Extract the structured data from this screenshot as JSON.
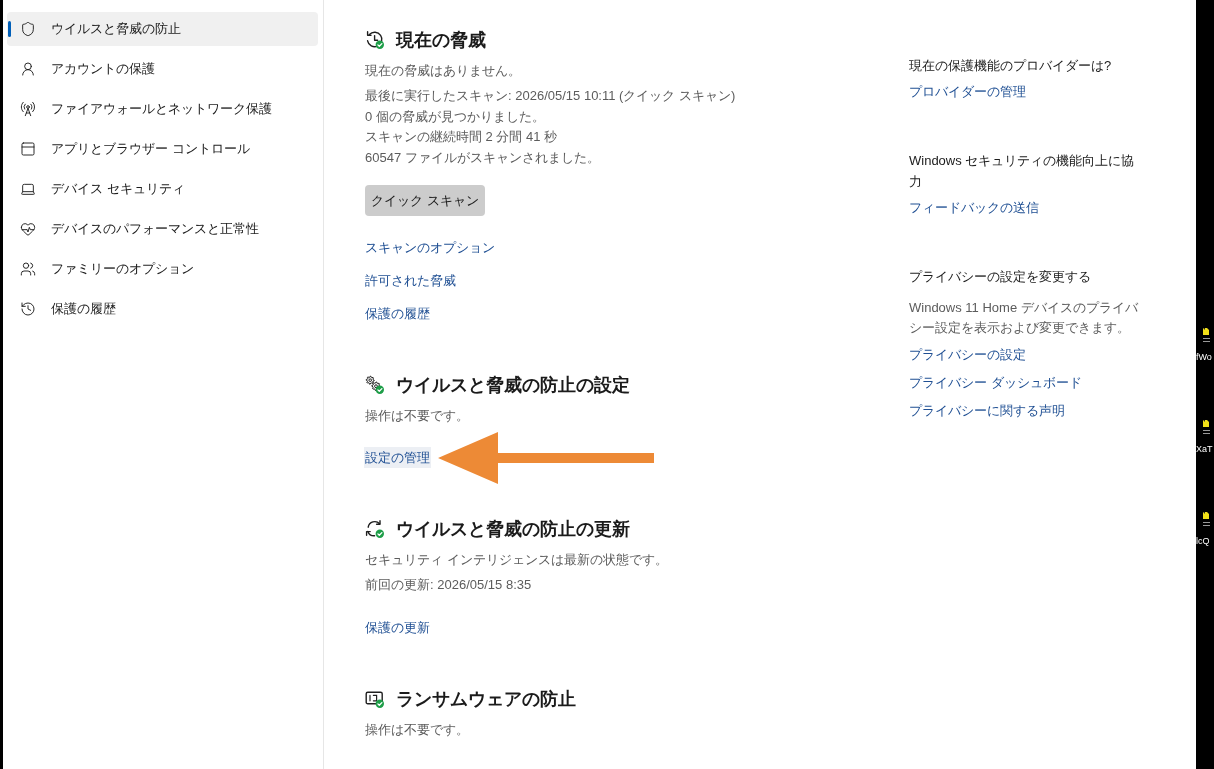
{
  "sidebar": {
    "items": [
      {
        "label": "ウイルスと脅威の防止",
        "selected": true
      },
      {
        "label": "アカウントの保護",
        "selected": false
      },
      {
        "label": "ファイアウォールとネットワーク保護",
        "selected": false
      },
      {
        "label": "アプリとブラウザー コントロール",
        "selected": false
      },
      {
        "label": "デバイス セキュリティ",
        "selected": false
      },
      {
        "label": "デバイスのパフォーマンスと正常性",
        "selected": false
      },
      {
        "label": "ファミリーのオプション",
        "selected": false
      },
      {
        "label": "保護の履歴",
        "selected": false
      }
    ]
  },
  "main": {
    "sections": [
      {
        "title": "現在の脅威",
        "status": "現在の脅威はありません。",
        "details": [
          "最後に実行したスキャン: 2026/05/15 10:11 (クイック スキャン)",
          "0 個の脅威が見つかりました。",
          "スキャンの継続時間 2 分間 41 秒",
          "60547 ファイルがスキャンされました。"
        ],
        "button": {
          "label": "クイック スキャン"
        },
        "links": [
          {
            "label": "スキャンのオプション",
            "hovered": false
          },
          {
            "label": "許可された脅威",
            "hovered": false
          },
          {
            "label": "保護の履歴",
            "hovered": false
          }
        ]
      },
      {
        "title": "ウイルスと脅威の防止の設定",
        "status": "操作は不要です。",
        "links": [
          {
            "label": "設定の管理",
            "hovered": true
          }
        ]
      },
      {
        "title": "ウイルスと脅威の防止の更新",
        "status": "セキュリティ インテリジェンスは最新の状態です。",
        "details": [
          "前回の更新: 2026/05/15 8:35"
        ],
        "links": [
          {
            "label": "保護の更新",
            "hovered": false
          }
        ]
      },
      {
        "title": "ランサムウェアの防止",
        "status": "操作は不要です。"
      }
    ],
    "annotation": {
      "kind": "arrow"
    }
  },
  "side_panel": {
    "groups": [
      {
        "heading": "現在の保護機能のプロバイダーは?",
        "links": [
          "プロバイダーの管理"
        ]
      },
      {
        "heading": "Windows セキュリティの機能向上に協力",
        "links": [
          "フィードバックの送信"
        ]
      },
      {
        "heading": "プライバシーの設定を変更する",
        "text": "Windows 11 Home デバイスのプライバシー設定を表示および変更できます。",
        "links": [
          "プライバシーの設定",
          "プライバシー ダッシュボード",
          "プライバシーに関する声明"
        ]
      }
    ]
  },
  "desktop": {
    "icons": [
      {
        "label": "fWo"
      },
      {
        "label": "XaT"
      },
      {
        "label": "lcQ"
      }
    ]
  }
}
